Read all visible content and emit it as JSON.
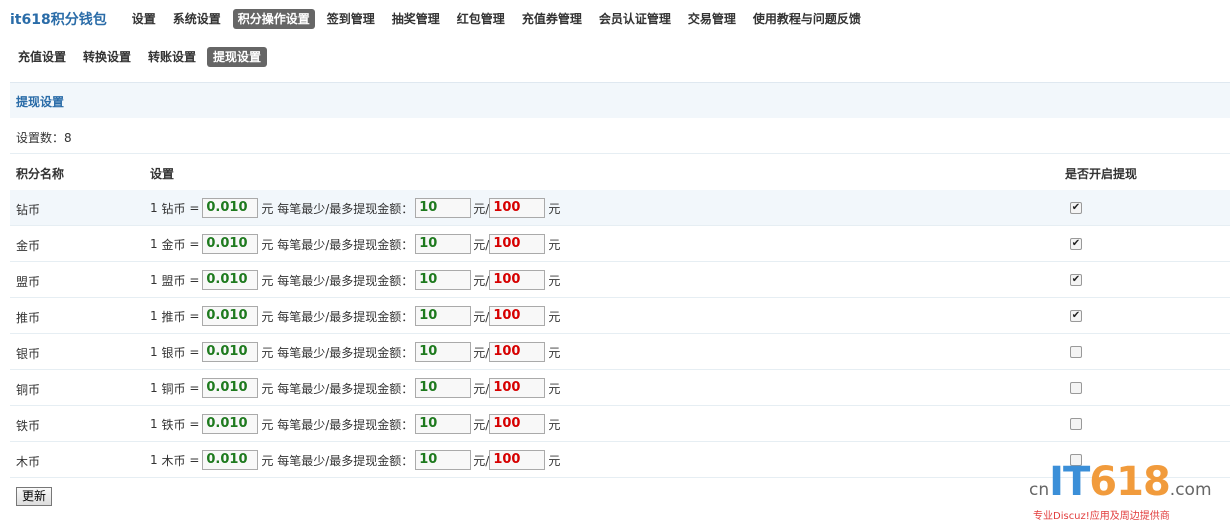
{
  "brand": "it618积分钱包",
  "top_nav": [
    {
      "label": "设置",
      "active": false
    },
    {
      "label": "系统设置",
      "active": false
    },
    {
      "label": "积分操作设置",
      "active": true
    },
    {
      "label": "签到管理",
      "active": false
    },
    {
      "label": "抽奖管理",
      "active": false
    },
    {
      "label": "红包管理",
      "active": false
    },
    {
      "label": "充值券管理",
      "active": false
    },
    {
      "label": "会员认证管理",
      "active": false
    },
    {
      "label": "交易管理",
      "active": false
    },
    {
      "label": "使用教程与问题反馈",
      "active": false
    }
  ],
  "sub_nav": [
    {
      "label": "充值设置",
      "active": false
    },
    {
      "label": "转换设置",
      "active": false
    },
    {
      "label": "转账设置",
      "active": false
    },
    {
      "label": "提现设置",
      "active": true
    }
  ],
  "panel_title": "提现设置",
  "count_text": "设置数：8",
  "columns": {
    "name": "积分名称",
    "setting": "设置",
    "enabled": "是否开启提现"
  },
  "labels": {
    "prefix": "1",
    "equals": "=",
    "yuan": "元",
    "per_limit": "每笔最少/最多提现金额：",
    "slash_yuan": "元/"
  },
  "rows": [
    {
      "name": "钻币",
      "rate": "0.010",
      "min": "10",
      "max": "100",
      "enabled": true
    },
    {
      "name": "金币",
      "rate": "0.010",
      "min": "10",
      "max": "100",
      "enabled": true
    },
    {
      "name": "盟币",
      "rate": "0.010",
      "min": "10",
      "max": "100",
      "enabled": true
    },
    {
      "name": "推币",
      "rate": "0.010",
      "min": "10",
      "max": "100",
      "enabled": true
    },
    {
      "name": "银币",
      "rate": "0.010",
      "min": "10",
      "max": "100",
      "enabled": false
    },
    {
      "name": "铜币",
      "rate": "0.010",
      "min": "10",
      "max": "100",
      "enabled": false
    },
    {
      "name": "铁币",
      "rate": "0.010",
      "min": "10",
      "max": "100",
      "enabled": false
    },
    {
      "name": "木币",
      "rate": "0.010",
      "min": "10",
      "max": "100",
      "enabled": false
    }
  ],
  "submit_label": "更新",
  "watermark": {
    "cn": "cn",
    "it": "IT",
    "num": "618",
    "com": ".com",
    "tagline": "专业Discuz!应用及周边提供商"
  },
  "colors": {
    "accent": "#2a6ca8",
    "rate": "#1e7a1e",
    "max": "#d60000",
    "active_tab": "#666666"
  }
}
